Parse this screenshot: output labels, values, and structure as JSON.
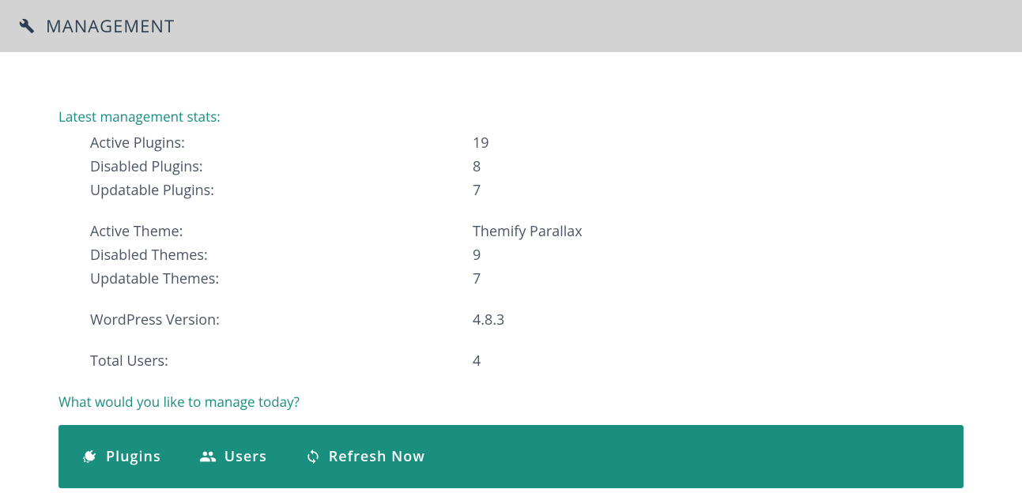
{
  "header": {
    "title": "MANAGEMENT"
  },
  "stats_section_label": "Latest management stats:",
  "stats": {
    "plugins": {
      "active_label": "Active Plugins:",
      "active_value": "19",
      "disabled_label": "Disabled Plugins:",
      "disabled_value": "8",
      "updatable_label": "Updatable Plugins:",
      "updatable_value": "7"
    },
    "themes": {
      "active_label": "Active Theme:",
      "active_value": "Themify Parallax",
      "disabled_label": "Disabled Themes:",
      "disabled_value": "9",
      "updatable_label": "Updatable Themes:",
      "updatable_value": "7"
    },
    "wordpress": {
      "version_label": "WordPress Version:",
      "version_value": "4.8.3"
    },
    "users": {
      "total_label": "Total Users:",
      "total_value": "4"
    }
  },
  "prompt_label": "What would you like to manage today?",
  "actions": {
    "plugins": "Plugins",
    "users": "Users",
    "refresh": "Refresh Now"
  }
}
